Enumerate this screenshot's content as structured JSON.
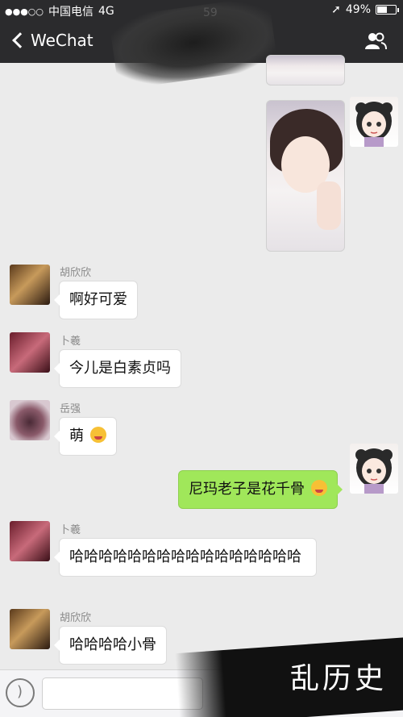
{
  "status_bar": {
    "carrier": "中国电信",
    "network": "4G",
    "battery": "49%",
    "battery_level": 0.49
  },
  "nav": {
    "back_label": "WeChat",
    "partial_time": "59"
  },
  "messages": [
    {
      "sender": "",
      "type": "image",
      "mine": true
    },
    {
      "sender": "胡欣欣",
      "text": "啊好可爱",
      "mine": false
    },
    {
      "sender": "卜羲",
      "text": "今儿是白素贞吗",
      "mine": false
    },
    {
      "sender": "岳强",
      "text": "萌",
      "mine": false,
      "emoji": "star-eyes-emoji"
    },
    {
      "sender": "",
      "text": "尼玛老子是花千骨",
      "mine": true,
      "emoji": "tongue-emoji"
    },
    {
      "sender": "卜羲",
      "text": "哈哈哈哈哈哈哈哈哈哈哈哈哈哈哈哈",
      "mine": false
    },
    {
      "sender": "胡欣欣",
      "text": "哈哈哈哈小骨",
      "mine": false
    }
  ],
  "watermark": "乱历史",
  "colors": {
    "nav_bg": "#2b2b2d",
    "chat_bg": "#ebebeb",
    "my_bubble": "#a0e75a"
  }
}
